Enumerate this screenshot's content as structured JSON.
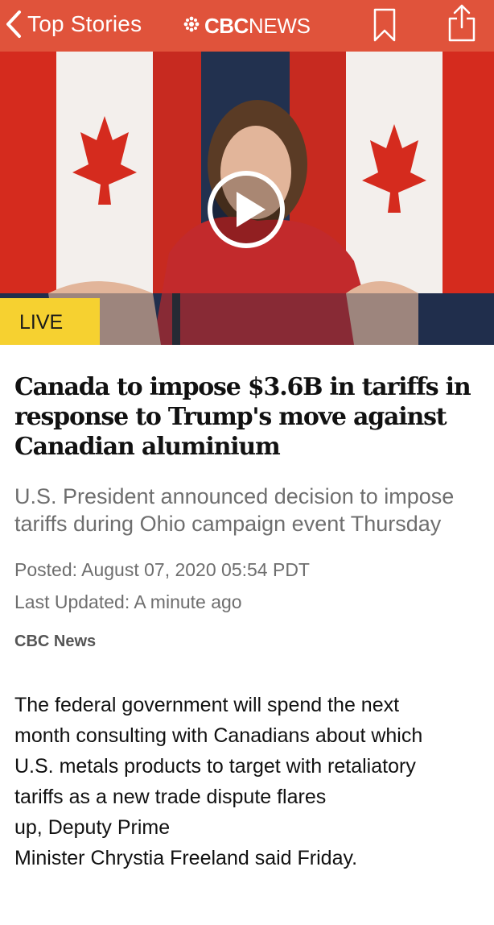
{
  "header": {
    "back_label": "Top Stories",
    "logo_cbc": "CBC",
    "logo_news": "NEWS",
    "icons": [
      "chevron-left-icon",
      "cbc-gem-icon",
      "bookmark-icon",
      "share-icon"
    ],
    "colors": {
      "bar": "#e0533b"
    }
  },
  "hero": {
    "badge": "LIVE",
    "icons": [
      "play-icon"
    ],
    "colors": {
      "badge": "#f6d130"
    }
  },
  "article": {
    "headline": "Canada to impose $3.6B in tariffs in response to Trump's move against Canadian aluminium",
    "subhead": "U.S. President announced decision to impose tariffs during Ohio campaign event Thursday",
    "posted": "Posted: August 07, 2020 05:54 PDT",
    "updated": "Last Updated: A minute ago",
    "source": "CBC News",
    "body_lines": [
      "The federal government will spend the next",
      "month consulting with Canadians about which",
      "U.S. metals products to target with retaliatory",
      "tariffs as a new trade dispute flares",
      "up, Deputy Prime",
      "Minister Chrystia Freeland said Friday."
    ]
  }
}
